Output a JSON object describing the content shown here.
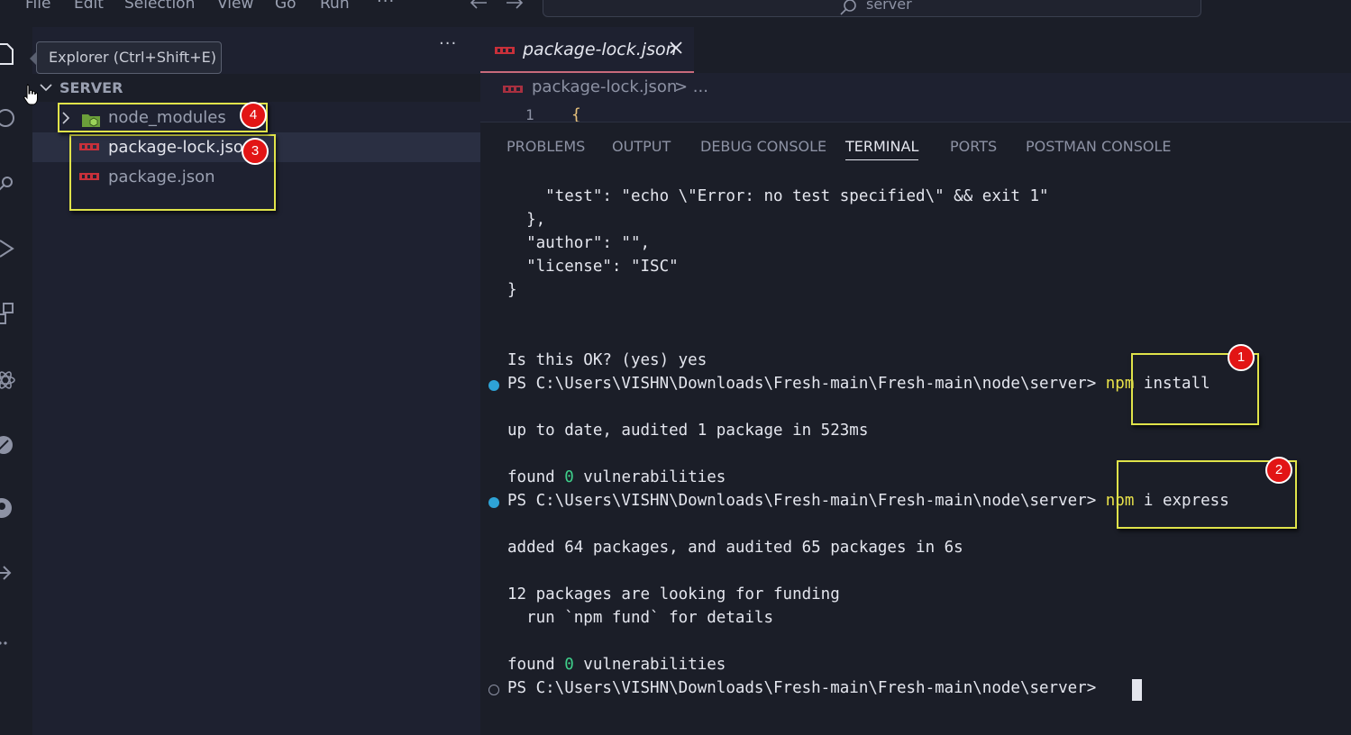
{
  "menu": {
    "items": [
      "File",
      "Edit",
      "Selection",
      "View",
      "Go",
      "Run"
    ],
    "more": "···"
  },
  "command_center": {
    "text": "server"
  },
  "explorer": {
    "tooltip": "Explorer (Ctrl+Shift+E)",
    "more": "···",
    "section_title": "SERVER",
    "items": [
      {
        "label": "node_modules",
        "type": "folder",
        "icon": "node-folder-icon"
      },
      {
        "label": "package-lock.json",
        "type": "file",
        "icon": "npm-icon"
      },
      {
        "label": "package.json",
        "type": "file",
        "icon": "npm-icon"
      }
    ]
  },
  "editor": {
    "tab_label": "package-lock.json",
    "breadcrumb_file": "package-lock.json",
    "breadcrumb_rest": "> ...",
    "line_number": "1",
    "line_code": "{"
  },
  "panel": {
    "tabs": [
      "PROBLEMS",
      "OUTPUT",
      "DEBUG CONSOLE",
      "TERMINAL",
      "PORTS",
      "POSTMAN CONSOLE"
    ],
    "active_tab": "TERMINAL"
  },
  "terminal": {
    "lines": [
      "    \"test\": \"echo \\\"Error: no test specified\\\" && exit 1\"",
      "  },",
      "  \"author\": \"\",",
      "  \"license\": \"ISC\"",
      "}",
      "Is this OK? (yes) yes",
      "PS C:\\Users\\VISHN\\Downloads\\Fresh-main\\Fresh-main\\node\\server> ",
      "up to date, audited 1 package in 523ms",
      "found ",
      "PS C:\\Users\\VISHN\\Downloads\\Fresh-main\\Fresh-main\\node\\server> ",
      "added 64 packages, and audited 65 packages in 6s",
      "12 packages are looking for funding",
      "  run `npm fund` for details",
      "found ",
      "PS C:\\Users\\VISHN\\Downloads\\Fresh-main\\Fresh-main\\node\\server> "
    ],
    "cmd1_npm": "npm",
    "cmd1_rest": " install",
    "cmd2_npm": "npm",
    "cmd2_rest": " i express",
    "zero": "0",
    "vuln_rest": " vulnerabilities"
  },
  "annotations": {
    "badges": [
      "1",
      "2",
      "3",
      "4"
    ],
    "highlight_color": "#e0e34a",
    "badge_color": "#e21515"
  },
  "colors": {
    "background": "#1b1e28",
    "sidebar": "#1e2130",
    "npm_highlight": "#e9e24a",
    "zero_green": "#3fd08b",
    "prompt_dot": "#2ea3d6"
  }
}
